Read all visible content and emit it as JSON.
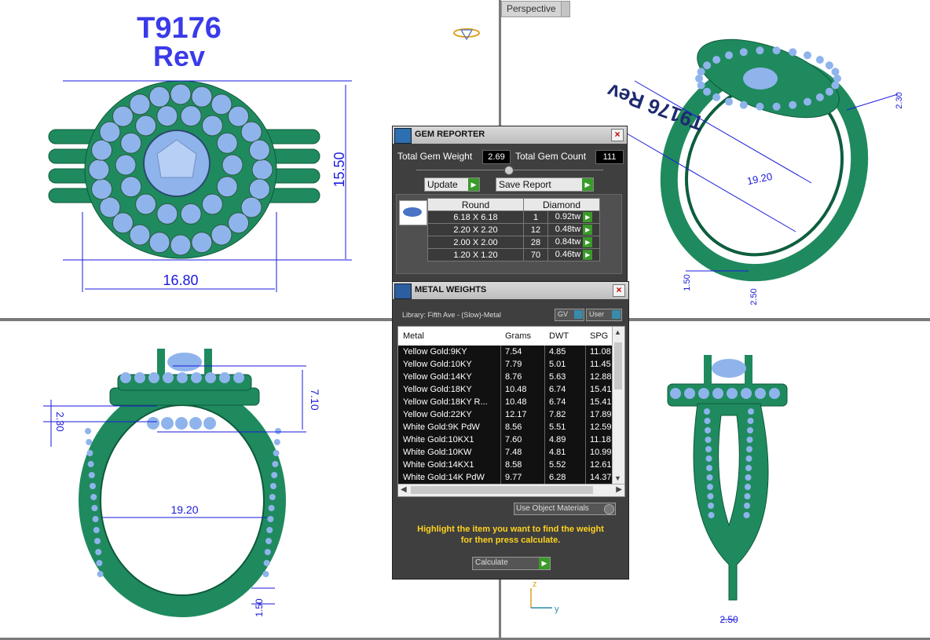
{
  "viewport": {
    "tab_label": "Perspective",
    "axis_z": "z",
    "axis_y": "y"
  },
  "top_left": {
    "model_code": "T9176",
    "model_rev": "Rev",
    "dim_height": "15.50",
    "dim_width": "16.80"
  },
  "top_right": {
    "dim_a": "2.30",
    "dim_b": "19.20",
    "dim_c": "1.50",
    "dim_d": "2.50",
    "engraving": "T9176 Rev"
  },
  "bottom_left": {
    "dim_height": "7.10",
    "dim_side": "2.30",
    "dim_width": "19.20",
    "dim_bottom": "1.50"
  },
  "bottom_right": {
    "dim_bottom": "2.50"
  },
  "gem_reporter": {
    "title": "GEM REPORTER",
    "total_weight_label": "Total Gem Weight",
    "total_weight_value": "2.69",
    "total_count_label": "Total Gem Count",
    "total_count_value": "111",
    "update_label": "Update",
    "save_label": "Save Report",
    "col_shape": "Round",
    "col_material": "Diamond",
    "rows": [
      {
        "size": "6.18 X 6.18",
        "count": "1",
        "weight": "0.92tw"
      },
      {
        "size": "2.20 X 2.20",
        "count": "12",
        "weight": "0.48tw"
      },
      {
        "size": "2.00 X 2.00",
        "count": "28",
        "weight": "0.84tw"
      },
      {
        "size": "1.20 X 1.20",
        "count": "70",
        "weight": "0.46tw"
      }
    ]
  },
  "metal_weights": {
    "title": "METAL WEIGHTS",
    "library": "Library: Fifth Ave - (Slow)-Metal",
    "gv_label": "GV",
    "user_label": "User",
    "columns": [
      "Metal",
      "Grams",
      "DWT",
      "SPG"
    ],
    "rows": [
      {
        "metal": "Yellow Gold:9KY",
        "grams": "7.54",
        "dwt": "4.85",
        "spg": "11.08"
      },
      {
        "metal": "Yellow Gold:10KY",
        "grams": "7.79",
        "dwt": "5.01",
        "spg": "11.45"
      },
      {
        "metal": "Yellow Gold:14KY",
        "grams": "8.76",
        "dwt": "5.63",
        "spg": "12.88"
      },
      {
        "metal": "Yellow Gold:18KY",
        "grams": "10.48",
        "dwt": "6.74",
        "spg": "15.41"
      },
      {
        "metal": "Yellow Gold:18KY R...",
        "grams": "10.48",
        "dwt": "6.74",
        "spg": "15.41"
      },
      {
        "metal": "Yellow Gold:22KY",
        "grams": "12.17",
        "dwt": "7.82",
        "spg": "17.89"
      },
      {
        "metal": "White Gold:9K PdW",
        "grams": "8.56",
        "dwt": "5.51",
        "spg": "12.59"
      },
      {
        "metal": "White Gold:10KX1",
        "grams": "7.60",
        "dwt": "4.89",
        "spg": "11.18"
      },
      {
        "metal": "White Gold:10KW",
        "grams": "7.48",
        "dwt": "4.81",
        "spg": "10.99"
      },
      {
        "metal": "White Gold:14KX1",
        "grams": "8.58",
        "dwt": "5.52",
        "spg": "12.61"
      },
      {
        "metal": "White Gold:14K PdW",
        "grams": "9.77",
        "dwt": "6.28",
        "spg": "14.37"
      }
    ],
    "use_object_materials": "Use Object Materials",
    "message_line1": "Highlight the item you want to find the weight",
    "message_line2": "for then press calculate.",
    "calculate_label": "Calculate"
  },
  "colors": {
    "ring_green": "#1f8a5e",
    "gem_blue": "#8fb4ec",
    "dimension_blue": "#1a1adc",
    "title_blue": "#3a3aea",
    "panel_bg": "#3f3f3f",
    "message_yellow": "#ffd21f"
  }
}
